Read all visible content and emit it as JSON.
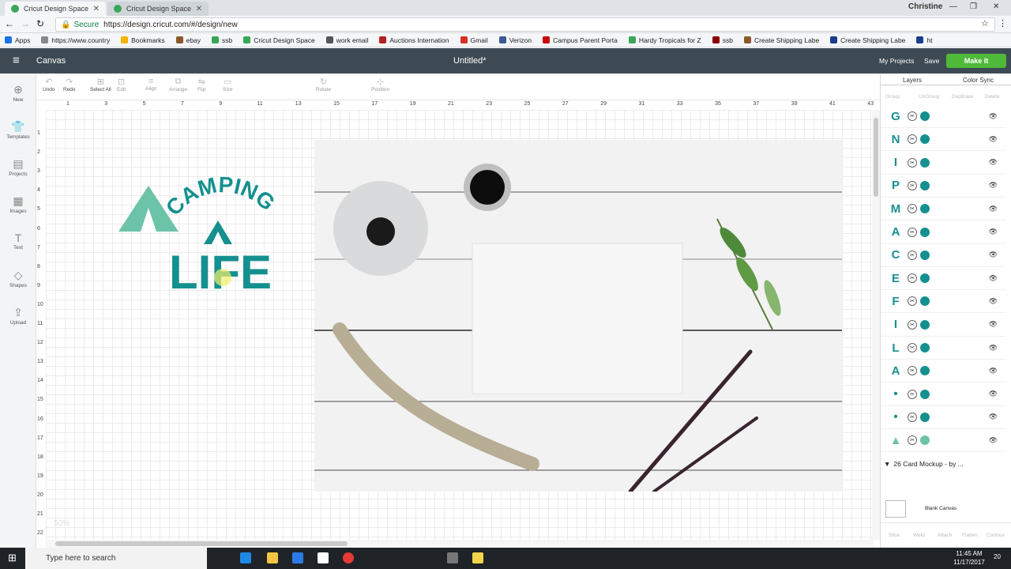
{
  "browser": {
    "tabs": [
      {
        "label": "Cricut Design Space"
      },
      {
        "label": "Cricut Design Space"
      }
    ],
    "user": "Christine",
    "secure_label": "Secure",
    "url": "https://design.cricut.com/#/design/new",
    "bookmarks": [
      "Apps",
      "https://www.country",
      "Bookmarks",
      "ebay",
      "ssb",
      "Cricut Design Space",
      "work email",
      "Auctions Internation",
      "Gmail",
      "Verizon",
      "Campus Parent Porta",
      "Hardy Tropicals for Z",
      "ssb",
      "Create Shipping Labe",
      "Create Shipping Labe",
      "ht"
    ]
  },
  "app": {
    "section": "Canvas",
    "document_title": "Untitled*",
    "my_projects": "My Projects",
    "save": "Save",
    "make_it": "Make It",
    "accent": "#4fb93a",
    "header_bg": "#3d4a53",
    "design_color": "#14908f"
  },
  "left_tools": [
    "New",
    "Templates",
    "Projects",
    "Images",
    "Text",
    "Shapes",
    "Upload"
  ],
  "edit_tools": [
    "Undo",
    "Redo",
    "Select All",
    "Edit",
    "Align",
    "Arrange",
    "Flip",
    "Size",
    "Rotate",
    "Position"
  ],
  "ruler": {
    "top": [
      "1",
      "3",
      "5",
      "7",
      "9",
      "11",
      "13",
      "15",
      "17",
      "19",
      "21",
      "23",
      "25",
      "27",
      "29",
      "31",
      "33",
      "35",
      "37",
      "39",
      "41",
      "43"
    ],
    "left": [
      "1",
      "2",
      "3",
      "4",
      "5",
      "6",
      "7",
      "8",
      "9",
      "10",
      "11",
      "12",
      "13",
      "14",
      "15",
      "16",
      "17",
      "18",
      "19",
      "20",
      "21",
      "22"
    ]
  },
  "canvas": {
    "design_text_top": "CAMPING",
    "design_text_bottom": "LIFE",
    "zoom": "50%"
  },
  "panel": {
    "tabs": [
      "Layers",
      "Color Sync"
    ],
    "actions": [
      "Group",
      "UnGroup",
      "Duplicate",
      "Delete"
    ],
    "layers": [
      "G",
      "N",
      "I",
      "P",
      "M",
      "A",
      "C",
      "E",
      "F",
      "I",
      "L",
      "A",
      "•",
      "•",
      "▲"
    ],
    "group_label": "26 Card Mockup - by ...",
    "blank_canvas": "Blank Canvas",
    "bottom_actions": [
      "Slice",
      "Weld",
      "Attach",
      "Flatten",
      "Contour"
    ]
  },
  "taskbar": {
    "search_placeholder": "Type here to search",
    "time": "11:45 AM",
    "date": "11/17/2017",
    "notifications": "20"
  }
}
